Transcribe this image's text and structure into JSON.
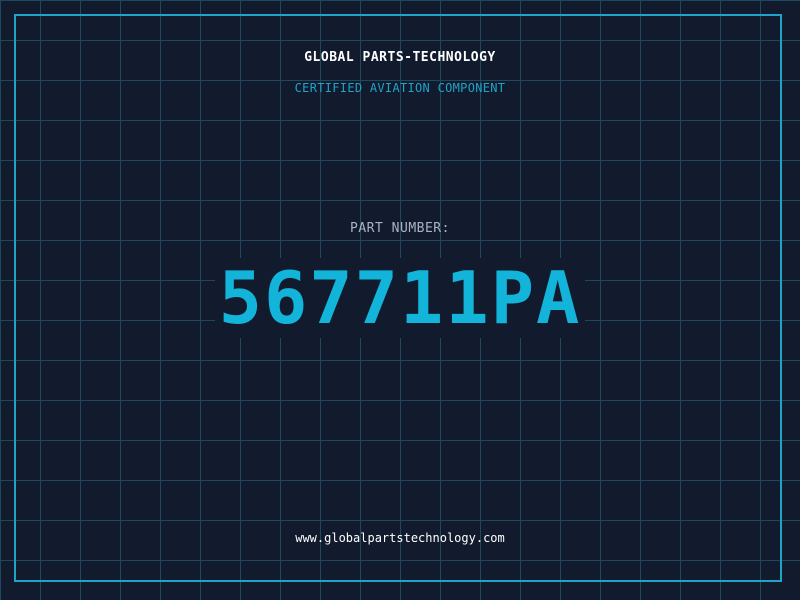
{
  "header": {
    "company": "GLOBAL PARTS-TECHNOLOGY",
    "subtitle": "CERTIFIED AVIATION COMPONENT"
  },
  "part": {
    "label": "PART NUMBER:",
    "number": "567711PA"
  },
  "footer": {
    "website": "www.globalpartstechnology.com"
  },
  "colors": {
    "background": "#121b2e",
    "grid": "#1d4a5e",
    "accent": "#1fa3c9",
    "part_number": "#12b5d9",
    "text": "#ffffff",
    "label": "#a8b4c4"
  }
}
